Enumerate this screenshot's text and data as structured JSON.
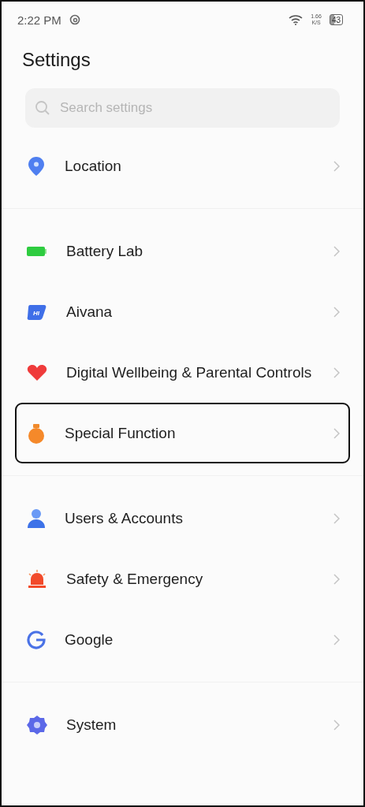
{
  "status_bar": {
    "time": "2:22 PM",
    "speed_value": "1.66",
    "speed_unit": "K/S",
    "battery": "43"
  },
  "title": "Settings",
  "search": {
    "placeholder": "Search settings"
  },
  "groups": [
    {
      "items": [
        {
          "kind": "location",
          "label": "Location",
          "highlighted": false
        }
      ]
    },
    {
      "items": [
        {
          "kind": "battery",
          "label": "Battery Lab",
          "highlighted": false
        },
        {
          "kind": "assistant",
          "label": "Aivana",
          "icon_text": "HI",
          "highlighted": false
        },
        {
          "kind": "wellbeing",
          "label": "Digital Wellbeing & Parental Controls",
          "highlighted": false
        },
        {
          "kind": "special",
          "label": "Special Function",
          "highlighted": true
        }
      ]
    },
    {
      "items": [
        {
          "kind": "users",
          "label": "Users & Accounts",
          "highlighted": false
        },
        {
          "kind": "safety",
          "label": "Safety & Emergency",
          "highlighted": false
        },
        {
          "kind": "google",
          "label": "Google",
          "highlighted": false
        }
      ]
    },
    {
      "items": [
        {
          "kind": "system",
          "label": "System",
          "highlighted": false
        }
      ]
    }
  ]
}
